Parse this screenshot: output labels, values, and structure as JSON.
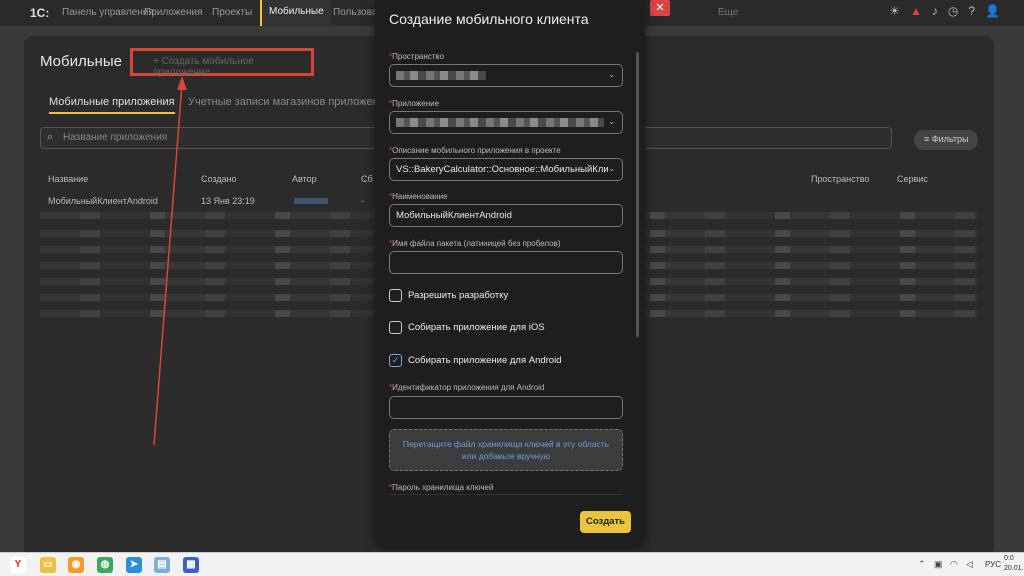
{
  "topbar": {
    "logo": "1С:",
    "nav": [
      "Панель управления",
      "Приложения",
      "Проекты",
      "Мобильные",
      "Пользова"
    ],
    "more": "Еще",
    "close": "✕"
  },
  "main": {
    "title": "Мобильные",
    "create_link": "+ Создать мобильное приложение",
    "tabs": [
      "Мобильные приложения",
      "Учетные записи магазинов приложен"
    ],
    "search_placeholder": "Название приложения",
    "filters": "Фильтры",
    "columns": [
      "Название",
      "Создано",
      "Автор",
      "Сб",
      "Пространство",
      "Сервис"
    ],
    "first_row": {
      "name": "МобильныйКлиентAndroid",
      "created": "13 Янв 23:19",
      "dash": "-"
    }
  },
  "modal": {
    "title": "Создание мобильного клиента",
    "fields": {
      "space_label": "Пространство",
      "app_label": "Приложение",
      "desc_label": "Описание мобильного приложения в проекте",
      "desc_value": "VS::BakeryCalculator::Основное::МобильныйКли",
      "name_label": "Наименование",
      "name_value": "МобильныйКлиентAndroid",
      "package_label": "Имя файла пакета (латиницей без пробелов)",
      "package_value": "",
      "android_id_label": "Идентификатор приложения для Android",
      "android_id_value": "",
      "keystore_pass_label": "Пароль хранилища ключей"
    },
    "checkboxes": [
      {
        "label": "Разрешить разработку",
        "checked": false
      },
      {
        "label": "Собирать приложение для iOS",
        "checked": false
      },
      {
        "label": "Собирать приложение для Android",
        "checked": true
      }
    ],
    "dropzone": "Перетащите файл хранилища ключей в эту область или добавьте вручную",
    "create_button": "Создать"
  },
  "taskbar": {
    "lang": "РУС",
    "time": "0:0",
    "date": "20.01."
  },
  "colors": {
    "accent": "#e9c43d",
    "highlight": "#d9453b",
    "link": "#6d9ee0"
  }
}
